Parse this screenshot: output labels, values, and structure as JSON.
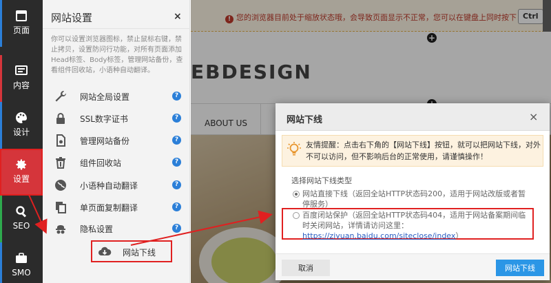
{
  "sidebar": {
    "items": [
      {
        "label": "页面",
        "icon": "page-icon",
        "edge_color": "#2b7fd8"
      },
      {
        "label": "内容",
        "icon": "content-icon",
        "edge_color": "#d5353b"
      },
      {
        "label": "设计",
        "icon": "palette-icon",
        "edge_color": "#2b7fd8"
      },
      {
        "label": "设置",
        "icon": "gear-icon",
        "edge_color": "#d5353b"
      },
      {
        "label": "SEO",
        "icon": "search-icon",
        "edge_color": "#2eaa4d"
      },
      {
        "label": "SMO",
        "icon": "briefcase-icon",
        "edge_color": "#2b7fd8"
      }
    ],
    "active_color": "#d5353b"
  },
  "panel": {
    "title": "网站设置",
    "close": "×",
    "description": "你可以设置浏览器图标，禁止鼠标右键，禁止拷贝，设置防问行功能，对所有页面添加Head标签、Body标签，管理网站备份，查看组件回收站，小语种自动翻译。",
    "items": [
      {
        "label": "网站全局设置",
        "icon": "wrench-icon"
      },
      {
        "label": "SSL数字证书",
        "icon": "lock-icon"
      },
      {
        "label": "管理网站备份",
        "icon": "backup-icon"
      },
      {
        "label": "组件回收站",
        "icon": "trash-icon"
      },
      {
        "label": "小语种自动翻译",
        "icon": "globe-icon"
      },
      {
        "label": "单页面复制翻译",
        "icon": "copy-icon"
      },
      {
        "label": "隐私设置",
        "icon": "privacy-icon"
      },
      {
        "label": "网站下线",
        "icon": "cloud-download-icon"
      }
    ],
    "help": "?"
  },
  "preview": {
    "notice": "您的浏览器目前处于缩放状态哦，会导致页面显示不正常，您可以在键盘上同时按下",
    "notice_icon": "!",
    "ctrl": "Ctrl",
    "brand": "EBDESIGN",
    "nav_about": "ABOUT US",
    "plus": "+"
  },
  "modal": {
    "title": "网站下线",
    "close": "×",
    "tip": "友情提醒：点击右下角的【网站下线】按钮，就可以把网站下线，对外不可以访问，但不影响后台的正常使用，请谨慎操作！",
    "section_label": "选择网站下线类型",
    "option1": "网站直接下线（返回全站HTTP状态码200，适用于网站改版或者暂停服务）",
    "option2": "百度闭站保护（返回全站HTTP状态码404，适用于网站备案期间临时关闭网站，详情请访问这里：",
    "option2_link": "https://ziyuan.baidu.com/siteclose/index",
    "option2_end": "）",
    "cancel": "取消",
    "confirm": "网站下线"
  },
  "colors": {
    "annotation_red": "#e02020",
    "confirm_blue": "#2b96e6",
    "sidebar_bg": "#2b2b2b"
  }
}
